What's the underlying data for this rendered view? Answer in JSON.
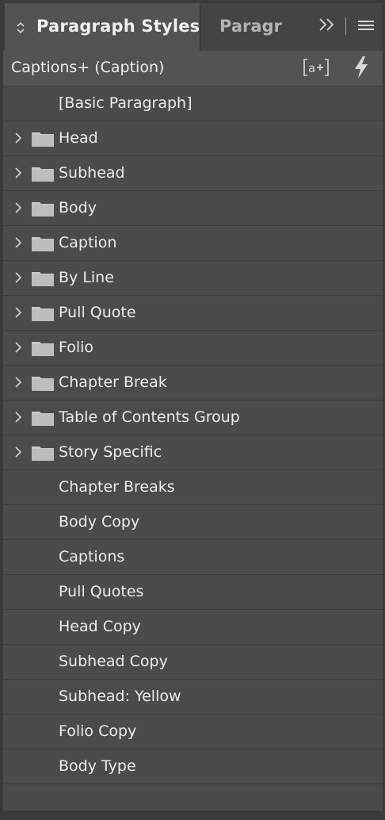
{
  "tabs": {
    "active_label": "Paragraph Styles",
    "inactive_label": "Paragraph"
  },
  "icons": {
    "collapse": "collapse-arrows-icon",
    "more": "double-chevron-right-icon",
    "menu": "panel-menu-icon",
    "new_style": "new-style-icon",
    "quick_apply": "lightning-bolt-icon",
    "chevron": "chevron-right-icon",
    "folder": "folder-icon"
  },
  "header": {
    "current_style": "Captions+ (Caption)",
    "new_style_glyph": "[a+]"
  },
  "styles": [
    {
      "label": "[Basic Paragraph]",
      "group": false
    },
    {
      "label": "Head",
      "group": true
    },
    {
      "label": "Subhead",
      "group": true
    },
    {
      "label": "Body",
      "group": true
    },
    {
      "label": "Caption",
      "group": true
    },
    {
      "label": "By Line",
      "group": true
    },
    {
      "label": "Pull Quote",
      "group": true
    },
    {
      "label": "Folio",
      "group": true
    },
    {
      "label": "Chapter Break",
      "group": true
    },
    {
      "label": "Table of Contents Group",
      "group": true
    },
    {
      "label": "Story Specific",
      "group": true
    },
    {
      "label": "Chapter Breaks",
      "group": false
    },
    {
      "label": "Body Copy",
      "group": false
    },
    {
      "label": "Captions",
      "group": false
    },
    {
      "label": "Pull Quotes",
      "group": false
    },
    {
      "label": "Head Copy",
      "group": false
    },
    {
      "label": "Subhead Copy",
      "group": false
    },
    {
      "label": "Subhead: Yellow",
      "group": false
    },
    {
      "label": "Folio Copy",
      "group": false
    },
    {
      "label": "Body Type",
      "group": false
    }
  ],
  "colors": {
    "panel_bg": "#535353",
    "row_bg": "#4b4b4b",
    "text": "#ececec",
    "folder": "#c8c8c8"
  }
}
